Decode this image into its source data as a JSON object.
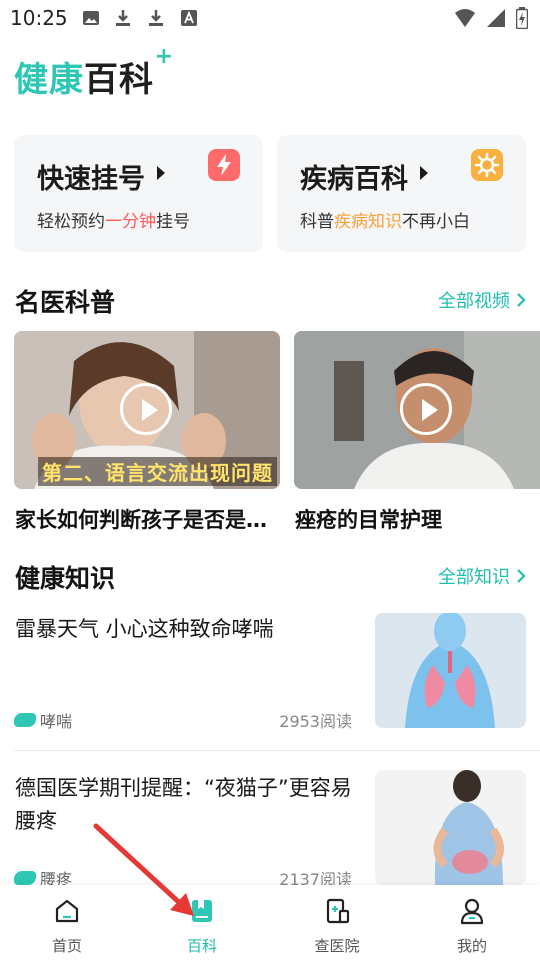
{
  "status_bar": {
    "time": "10:25"
  },
  "header": {
    "title_part1": "健康",
    "title_part2": "百科",
    "title_plus": "+"
  },
  "cards": [
    {
      "title": "快速挂号",
      "sub_before": "轻松预约",
      "sub_highlight": "一分钟",
      "sub_after": "挂号"
    },
    {
      "title": "疾病百科",
      "sub_before": "科普",
      "sub_highlight": "疾病知识",
      "sub_after": "不再小白"
    }
  ],
  "videos_section": {
    "title": "名医科普",
    "more": "全部视频"
  },
  "videos": [
    {
      "caption": "家长如何判断孩子是否是…",
      "banner": "第二、语言交流出现问题"
    },
    {
      "caption": "痤疮的目常护理"
    }
  ],
  "knowledge_section": {
    "title": "健康知识",
    "more": "全部知识"
  },
  "articles": [
    {
      "title": "雷暴天气 小心这种致命哮喘",
      "tag": "哮喘",
      "reads": "2953阅读"
    },
    {
      "title": "德国医学期刊提醒：“夜猫子”更容易腰疼",
      "tag": "腰疼",
      "reads": "2137阅读"
    }
  ],
  "nav": [
    {
      "label": "首页",
      "icon": "home-icon"
    },
    {
      "label": "百科",
      "icon": "encyclopedia-icon",
      "active": true
    },
    {
      "label": "查医院",
      "icon": "hospital-icon"
    },
    {
      "label": "我的",
      "icon": "profile-icon"
    }
  ],
  "colors": {
    "accent": "#2ec7b5",
    "red": "#ff5a5a",
    "orange": "#f7a23b",
    "annotation": "#e53935"
  }
}
